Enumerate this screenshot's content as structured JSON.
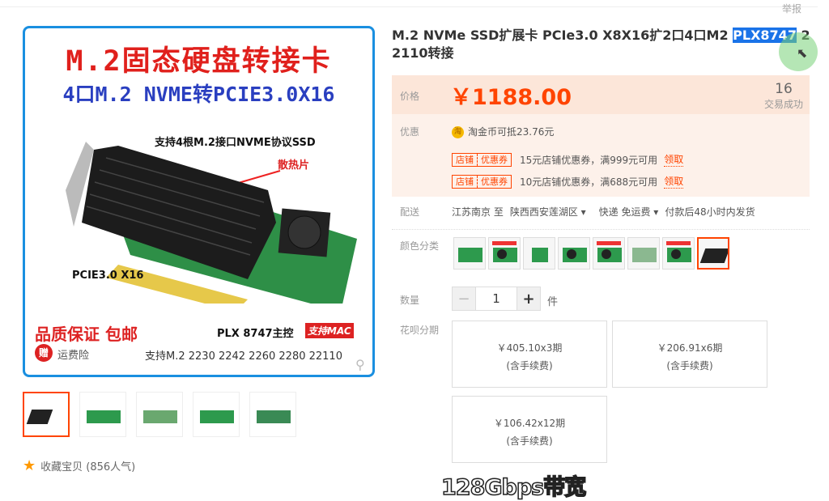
{
  "header": {
    "report": "举报"
  },
  "gallery": {
    "main": {
      "title1": "M.2固态硬盘转接卡",
      "title2": "4口M.2 NVME转PCIE3.0X16",
      "support": "支持4根M.2接口NVME协议SSD",
      "heatsink": "散热片",
      "slot": "PCIE3.0 X16",
      "quality": "品质保证 包邮",
      "gift": "赠",
      "insurance": "运费险",
      "chip": "PLX 8747主控",
      "mac": "支持MAC",
      "sizes": "支持M.2 2230 2242 2260 2280 22110"
    },
    "thumbnails": 5,
    "favorite": "收藏宝贝 (856人气)"
  },
  "product": {
    "title_pre": "M.2 NVMe SSD扩展卡 PCIe3.0 X8X16扩2口4口M2 ",
    "title_sel": "PLX8747",
    "title_post": " 2 2110转接",
    "price_label": "价格",
    "price": "￥1188.00",
    "sold_count": "16",
    "sold_label": "交易成功",
    "promo_label": "优惠",
    "coin_icon": "淘",
    "coin_text": "淘金币可抵23.76元",
    "coupons": [
      {
        "tag1": "店铺",
        "tag2": "优惠券",
        "text": "15元店铺优惠券，满999元可用",
        "action": "领取"
      },
      {
        "tag1": "店铺",
        "tag2": "优惠券",
        "text": "10元店铺优惠券，满688元可用",
        "action": "领取"
      }
    ],
    "delivery_label": "配送",
    "from": "江苏南京 至",
    "to": "陕西西安莲湖区 ▾",
    "shipping": "快递 免运费 ▾",
    "ship_time": "付款后48小时内发货",
    "color_label": "颜色分类",
    "colors": 8,
    "selected_color": 8,
    "qty_label": "数量",
    "qty": "1",
    "minus": "−",
    "plus": "+",
    "unit": "件",
    "huabei_label": "花呗分期",
    "installments": [
      {
        "amount": "￥405.10x3期",
        "fee": "(含手续费)"
      },
      {
        "amount": "￥206.91x6期",
        "fee": "(含手续费)"
      },
      {
        "amount": "￥106.42x12期",
        "fee": "(含手续费)"
      }
    ]
  },
  "caption": "128Gbps带宽"
}
